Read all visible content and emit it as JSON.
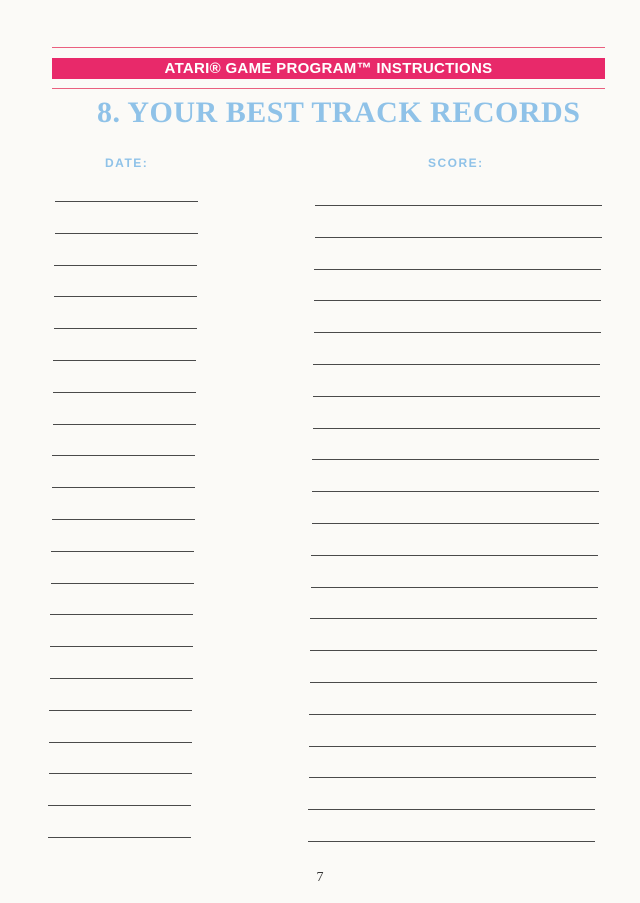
{
  "banner": {
    "text": "ATARI® GAME PROGRAM™ INSTRUCTIONS"
  },
  "title": "8.  YOUR BEST TRACK RECORDS",
  "columns": {
    "date_label": "DATE:",
    "score_label": "SCORE:"
  },
  "record_rows": 21,
  "page_number": "7",
  "colors": {
    "banner_pink": "#e8296a",
    "title_blue": "#8fc2e8"
  }
}
